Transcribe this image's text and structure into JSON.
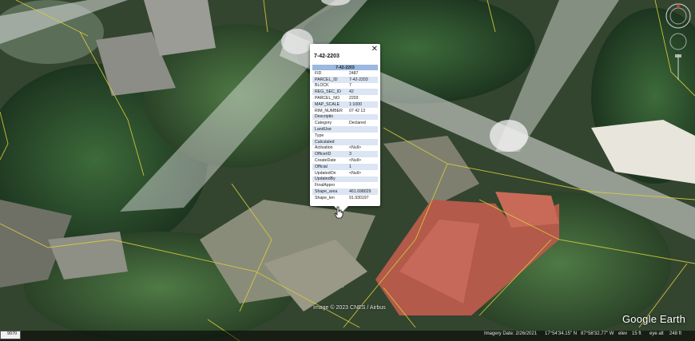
{
  "popup": {
    "title": "7-42-2203",
    "close_glyph": "✕",
    "table_header": "7-42-2203",
    "rows": [
      {
        "key": "FID",
        "value": "2487"
      },
      {
        "key": "PARCEL_ID",
        "value": "7-42-2203"
      },
      {
        "key": "BLOCK",
        "value": "7"
      },
      {
        "key": "REG_SEC_ID",
        "value": "42"
      },
      {
        "key": "PARCEL_NO",
        "value": "2203"
      },
      {
        "key": "MAP_SCALE",
        "value": "1:1000"
      },
      {
        "key": "RIM_NUMBER",
        "value": "07 42 13"
      },
      {
        "key": "Descriptio",
        "value": ""
      },
      {
        "key": "Category",
        "value": "Declared"
      },
      {
        "key": "LandUse",
        "value": ""
      },
      {
        "key": "Type",
        "value": ""
      },
      {
        "key": "Calculated",
        "value": ""
      },
      {
        "key": "Activation",
        "value": "<Null>"
      },
      {
        "key": "OfficerID",
        "value": "3"
      },
      {
        "key": "CreateDate",
        "value": "<Null>"
      },
      {
        "key": "Official",
        "value": "1"
      },
      {
        "key": "UpdatedOn",
        "value": "<Null>"
      },
      {
        "key": "UpdatedBy",
        "value": ""
      },
      {
        "key": "FinalAppro",
        "value": ""
      },
      {
        "key": "Shape_area",
        "value": "461.698029"
      },
      {
        "key": "Shape_len",
        "value": "91.930197"
      }
    ]
  },
  "map": {
    "credit": "Image © 2023 CNES / Airbus",
    "logo": "Google Earth",
    "colors": {
      "parcel_line": "#d9cf3a",
      "popup_header": "#9bb8de",
      "popup_alt_row": "#dbe5f3"
    }
  },
  "status_bar": {
    "scale_label": "9970",
    "imagery_date": "Imagery Date: 2/26/2021",
    "latitude": "17°54'34.15\" N",
    "longitude": "87°58'32.77\" W",
    "elev_label": "elev",
    "elev_value": "15 ft",
    "eye_alt_label": "eye alt",
    "eye_alt_value": "248 ft"
  },
  "icons": [
    "compass-icon",
    "look-joystick-icon",
    "zoom-slider-icon",
    "close-icon",
    "hand-cursor-icon"
  ]
}
